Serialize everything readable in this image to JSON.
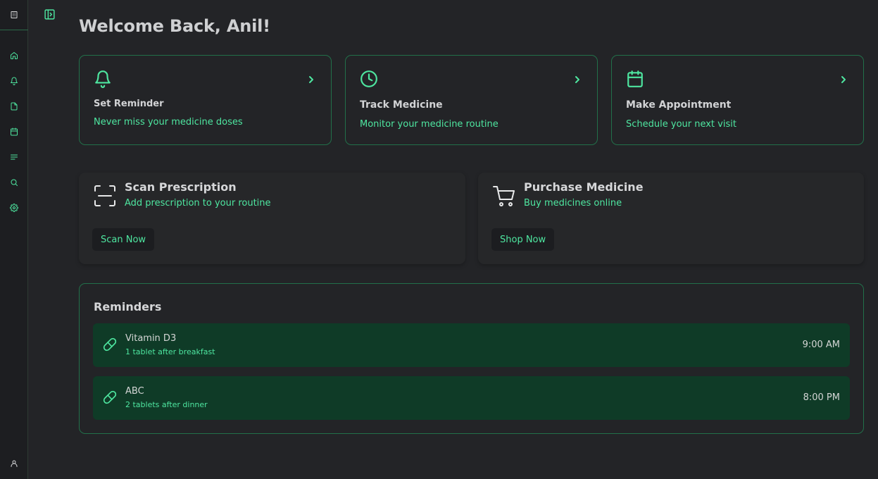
{
  "header": {
    "title": "Welcome Back, Anil!"
  },
  "sidebar": {
    "logo_icon": "building-icon",
    "items": [
      {
        "icon": "home-icon"
      },
      {
        "icon": "bell-icon"
      },
      {
        "icon": "file-icon"
      },
      {
        "icon": "calendar-icon"
      },
      {
        "icon": "list-icon"
      },
      {
        "icon": "search-icon"
      },
      {
        "icon": "settings-icon"
      }
    ],
    "footer_icon": "user-icon"
  },
  "quick_cards": [
    {
      "title": "Set Reminder",
      "subtitle": "Never miss your medicine doses",
      "icon": "bell-icon"
    },
    {
      "title": "Track Medicine",
      "subtitle": "Monitor your medicine routine",
      "icon": "clock-icon"
    },
    {
      "title": "Make Appointment",
      "subtitle": "Schedule your next visit",
      "icon": "calendar-icon"
    }
  ],
  "actions": [
    {
      "title": "Scan Prescription",
      "subtitle": "Add prescription to your routine",
      "button": "Scan Now",
      "icon": "scan-icon"
    },
    {
      "title": "Purchase Medicine",
      "subtitle": "Buy medicines online",
      "button": "Shop Now",
      "icon": "cart-icon"
    }
  ],
  "reminders": {
    "title": "Reminders",
    "items": [
      {
        "name": "Vitamin D3",
        "dose": "1 tablet after breakfast",
        "time": "9:00 AM"
      },
      {
        "name": "ABC",
        "dose": "2 tablets after dinner",
        "time": "8:00 PM"
      }
    ]
  },
  "colors": {
    "accent": "#4ee6a0",
    "background": "#232427",
    "card_border": "#22704a",
    "reminder_bg": "#0f3b27"
  }
}
